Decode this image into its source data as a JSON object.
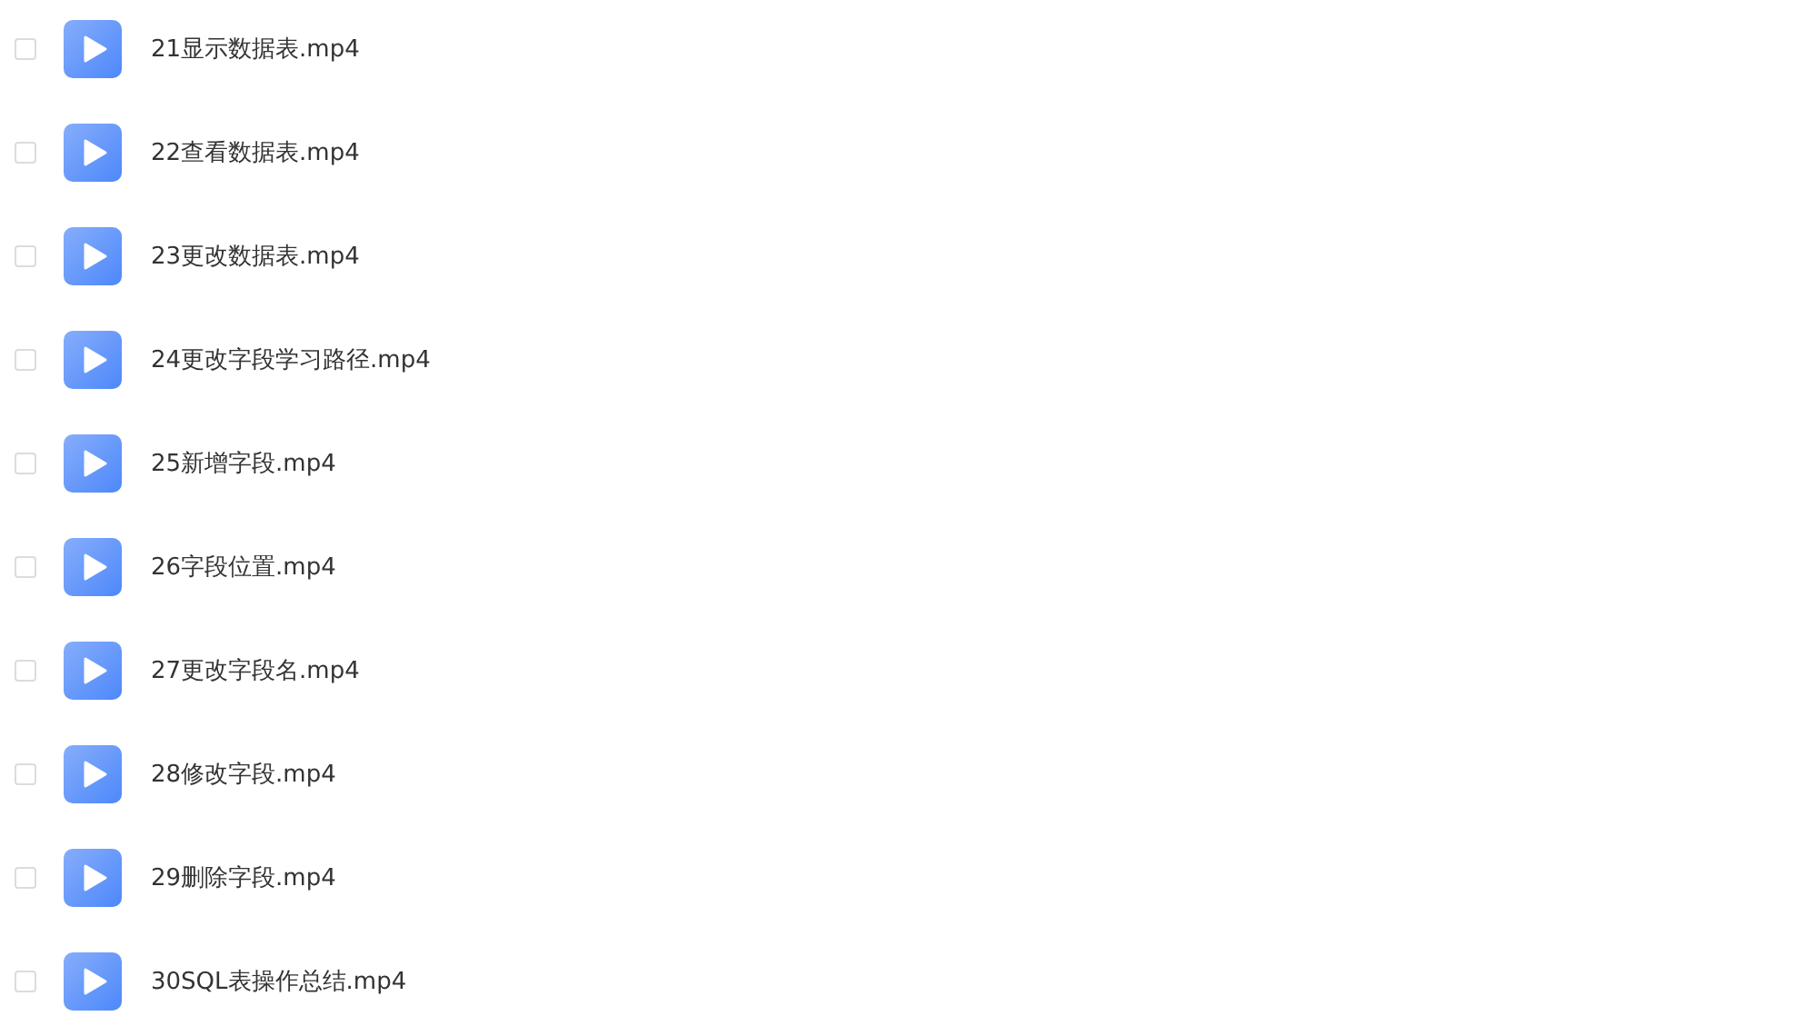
{
  "files": [
    {
      "name": "21显示数据表.mp4",
      "checked": false
    },
    {
      "name": "22查看数据表.mp4",
      "checked": false
    },
    {
      "name": "23更改数据表.mp4",
      "checked": false
    },
    {
      "name": "24更改字段学习路径.mp4",
      "checked": false
    },
    {
      "name": "25新增字段.mp4",
      "checked": false
    },
    {
      "name": "26字段位置.mp4",
      "checked": false
    },
    {
      "name": "27更改字段名.mp4",
      "checked": false
    },
    {
      "name": "28修改字段.mp4",
      "checked": false
    },
    {
      "name": "29删除字段.mp4",
      "checked": false
    },
    {
      "name": "30SQL表操作总结.mp4",
      "checked": false
    }
  ]
}
